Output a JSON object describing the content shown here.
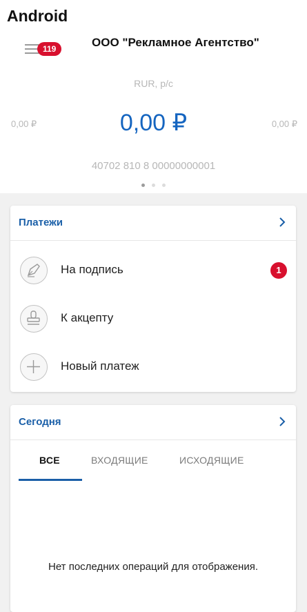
{
  "header": {
    "platform_label": "Android",
    "notifications_count": "119",
    "org_name": "ООО \"Рекламное Агентство\""
  },
  "account": {
    "currency": "RUR, р/с",
    "balance_main": "0,00 ₽",
    "balance_prev": "0,00 ₽",
    "balance_next": "0,00 ₽",
    "number": "40702 810 8 00000000001",
    "pager_total": 3,
    "pager_active": 1
  },
  "payments": {
    "title": "Платежи",
    "items": [
      {
        "label": "На подпись",
        "icon": "pen-nib-icon",
        "badge": "1"
      },
      {
        "label": "К акцепту",
        "icon": "stamp-icon",
        "badge": ""
      },
      {
        "label": "Новый платеж",
        "icon": "plus-icon",
        "badge": ""
      }
    ]
  },
  "today": {
    "title": "Сегодня",
    "tabs": [
      {
        "label": "ВСЕ",
        "active": true
      },
      {
        "label": "ВХОДЯЩИЕ",
        "active": false
      },
      {
        "label": "ИСХОДЯЩИЕ",
        "active": false
      }
    ],
    "empty_message": "Нет последних операций для отображения."
  },
  "colors": {
    "accent": "#1a5fa8",
    "balance": "#1565c0",
    "badge": "#d8102e"
  }
}
